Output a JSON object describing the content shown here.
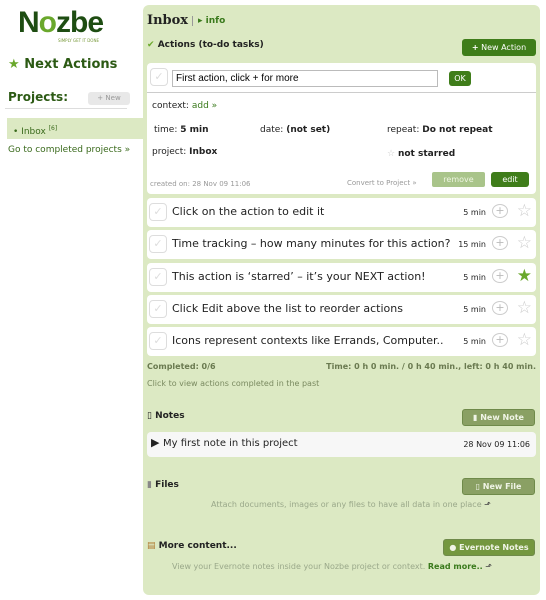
{
  "logo": {
    "text_a": "N",
    "text_o": "o",
    "text_b": "zbe",
    "tagline": "SIMPLY GET IT DONE"
  },
  "sidebar": {
    "next_actions": "Next Actions",
    "projects_label": "Projects:",
    "new_label": "New",
    "items": [
      {
        "label": "Inbox",
        "count": "[6]"
      }
    ],
    "completed_link": "Go to completed projects »"
  },
  "header": {
    "title": "Inbox",
    "info": "info"
  },
  "actions": {
    "heading": "Actions (to-do tasks)",
    "new_action": "New Action",
    "edit": {
      "input_value": "First action, click + for more",
      "ok": "OK",
      "context_label": "context:",
      "context_value": "add »",
      "time_label": "time:",
      "time_value": "5 min",
      "date_label": "date:",
      "date_value": "(not set)",
      "repeat_label": "repeat:",
      "repeat_value": "Do not repeat",
      "project_label": "project:",
      "project_value": "Inbox",
      "starred": "not starred",
      "created": "created on: 28 Nov 09 11:06",
      "convert": "Convert to Project »",
      "remove": "remove",
      "edit": "edit"
    },
    "items": [
      {
        "text": "Click on the action to edit it",
        "time": "5 min",
        "starred": false
      },
      {
        "text": "Time tracking – how many minutes for this action?",
        "time": "15 min",
        "starred": false
      },
      {
        "text": "This action is ‘starred’ – it’s your NEXT action!",
        "time": "5 min",
        "starred": true
      },
      {
        "text": "Click Edit above the list to reorder actions",
        "time": "5 min",
        "starred": false
      },
      {
        "text": "Icons represent contexts like Errands, Computer..",
        "time": "5 min",
        "starred": false
      }
    ],
    "completed": "Completed: 0/6",
    "time_summary": "Time: 0 h 0 min. / 0 h 40 min., left: 0 h 40 min.",
    "view_past": "Click to view actions completed in the past"
  },
  "notes": {
    "heading": "Notes",
    "new_note": "New Note",
    "items": [
      {
        "title": "My first note in this project",
        "date": "28 Nov 09 11:06"
      }
    ]
  },
  "files": {
    "heading": "Files",
    "new_file": "New File",
    "hint": "Attach documents, images or any files to have all data in one place"
  },
  "more": {
    "heading": "More content...",
    "evernote": "Evernote Notes",
    "hint": "View your Evernote notes inside your Nozbe project or context.",
    "read_more": "Read more.."
  },
  "colors": {
    "panel": "#dce9c3",
    "accent": "#3f7d1a"
  }
}
